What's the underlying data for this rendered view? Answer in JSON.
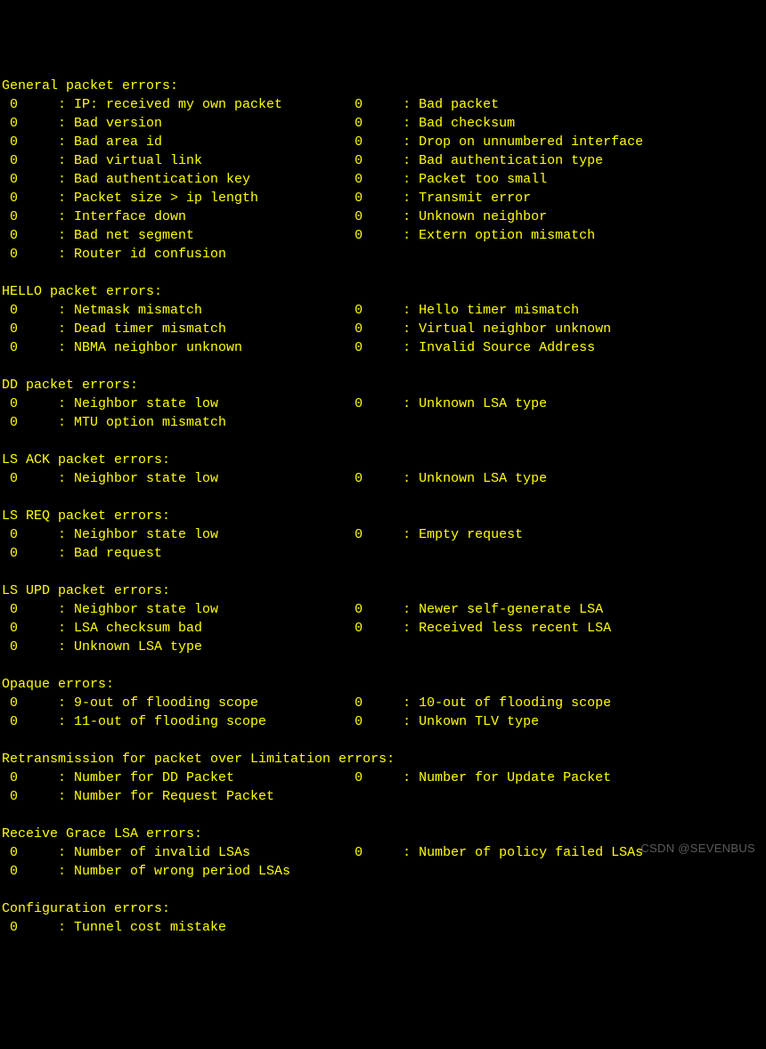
{
  "watermark": "CSDN @SEVENBUS",
  "sections": [
    {
      "title": "General packet errors:",
      "rows": [
        [
          {
            "v": "0",
            "l": "IP: received my own packet"
          },
          {
            "v": "0",
            "l": "Bad packet"
          }
        ],
        [
          {
            "v": "0",
            "l": "Bad version"
          },
          {
            "v": "0",
            "l": "Bad checksum"
          }
        ],
        [
          {
            "v": "0",
            "l": "Bad area id"
          },
          {
            "v": "0",
            "l": "Drop on unnumbered interface"
          }
        ],
        [
          {
            "v": "0",
            "l": "Bad virtual link"
          },
          {
            "v": "0",
            "l": "Bad authentication type"
          }
        ],
        [
          {
            "v": "0",
            "l": "Bad authentication key"
          },
          {
            "v": "0",
            "l": "Packet too small"
          }
        ],
        [
          {
            "v": "0",
            "l": "Packet size > ip length"
          },
          {
            "v": "0",
            "l": "Transmit error"
          }
        ],
        [
          {
            "v": "0",
            "l": "Interface down"
          },
          {
            "v": "0",
            "l": "Unknown neighbor"
          }
        ],
        [
          {
            "v": "0",
            "l": "Bad net segment"
          },
          {
            "v": "0",
            "l": "Extern option mismatch"
          }
        ],
        [
          {
            "v": "0",
            "l": "Router id confusion"
          }
        ]
      ]
    },
    {
      "title": "HELLO packet errors:",
      "rows": [
        [
          {
            "v": "0",
            "l": "Netmask mismatch"
          },
          {
            "v": "0",
            "l": "Hello timer mismatch"
          }
        ],
        [
          {
            "v": "0",
            "l": "Dead timer mismatch"
          },
          {
            "v": "0",
            "l": "Virtual neighbor unknown"
          }
        ],
        [
          {
            "v": "0",
            "l": "NBMA neighbor unknown"
          },
          {
            "v": "0",
            "l": "Invalid Source Address"
          }
        ]
      ]
    },
    {
      "title": "DD packet errors:",
      "rows": [
        [
          {
            "v": "0",
            "l": "Neighbor state low"
          },
          {
            "v": "0",
            "l": "Unknown LSA type"
          }
        ],
        [
          {
            "v": "0",
            "l": "MTU option mismatch"
          }
        ]
      ]
    },
    {
      "title": "LS ACK packet errors:",
      "rows": [
        [
          {
            "v": "0",
            "l": "Neighbor state low"
          },
          {
            "v": "0",
            "l": "Unknown LSA type"
          }
        ]
      ]
    },
    {
      "title": "LS REQ packet errors:",
      "rows": [
        [
          {
            "v": "0",
            "l": "Neighbor state low"
          },
          {
            "v": "0",
            "l": "Empty request"
          }
        ],
        [
          {
            "v": "0",
            "l": "Bad request"
          }
        ]
      ]
    },
    {
      "title": "LS UPD packet errors:",
      "rows": [
        [
          {
            "v": "0",
            "l": "Neighbor state low"
          },
          {
            "v": "0",
            "l": "Newer self-generate LSA"
          }
        ],
        [
          {
            "v": "0",
            "l": "LSA checksum bad"
          },
          {
            "v": "0",
            "l": "Received less recent LSA"
          }
        ],
        [
          {
            "v": "0",
            "l": "Unknown LSA type"
          }
        ]
      ]
    },
    {
      "title": "Opaque errors:",
      "rows": [
        [
          {
            "v": "0",
            "l": "9-out of flooding scope"
          },
          {
            "v": "0",
            "l": "10-out of flooding scope"
          }
        ],
        [
          {
            "v": "0",
            "l": "11-out of flooding scope"
          },
          {
            "v": "0",
            "l": "Unkown TLV type"
          }
        ]
      ]
    },
    {
      "title": "Retransmission for packet over Limitation errors:",
      "rows": [
        [
          {
            "v": "0",
            "l": "Number for DD Packet"
          },
          {
            "v": "0",
            "l": "Number for Update Packet"
          }
        ],
        [
          {
            "v": "0",
            "l": "Number for Request Packet"
          }
        ]
      ]
    },
    {
      "title": "Receive Grace LSA errors:",
      "rows": [
        [
          {
            "v": "0",
            "l": "Number of invalid LSAs"
          },
          {
            "v": "0",
            "l": "Number of policy failed LSAs"
          }
        ],
        [
          {
            "v": "0",
            "l": "Number of wrong period LSAs"
          }
        ]
      ]
    },
    {
      "title": "Configuration errors:",
      "rows": [
        [
          {
            "v": "0",
            "l": "Tunnel cost mistake"
          }
        ]
      ]
    }
  ]
}
